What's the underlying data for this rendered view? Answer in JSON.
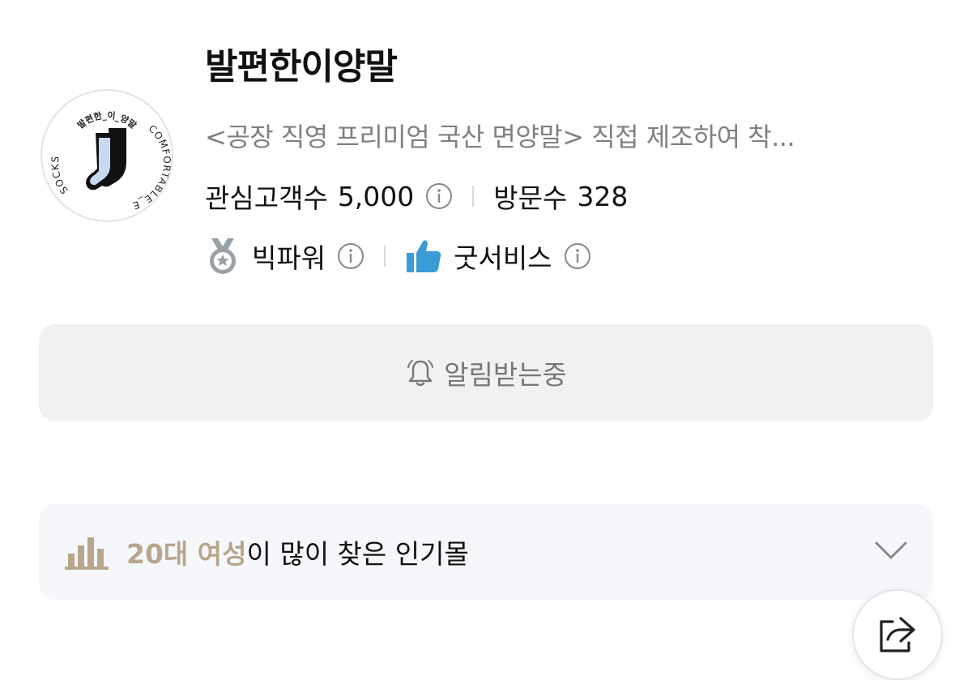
{
  "store": {
    "name": "발편한이양말",
    "description": "<공장 직영 프리미엄 국산 면양말> 직접 제조하여 착...",
    "logo": {
      "top_text": "발편한_이_양말",
      "right_text": "COMFORTABLE_E",
      "left_text": "SOCKS"
    }
  },
  "stats": {
    "followers_label": "관심고객수",
    "followers_value": "5,000",
    "visits_label": "방문수",
    "visits_value": "328"
  },
  "badges": {
    "grade_label": "빅파워",
    "service_label": "굿서비스"
  },
  "alarm_button": {
    "label": "알림받는중"
  },
  "popular": {
    "highlight": "20대 여성",
    "suffix": "이 많이 찾은 인기몰"
  },
  "colors": {
    "highlight": "#b7a58d",
    "thumb_icon": "#3a9bd5",
    "medal_icon": "#9aa1a8",
    "button_bg": "#f1f1f3"
  },
  "icons": [
    "info-icon",
    "medal-icon",
    "thumbs-up-icon",
    "bell-icon",
    "bar-chart-icon",
    "chevron-down-icon",
    "share-icon"
  ]
}
